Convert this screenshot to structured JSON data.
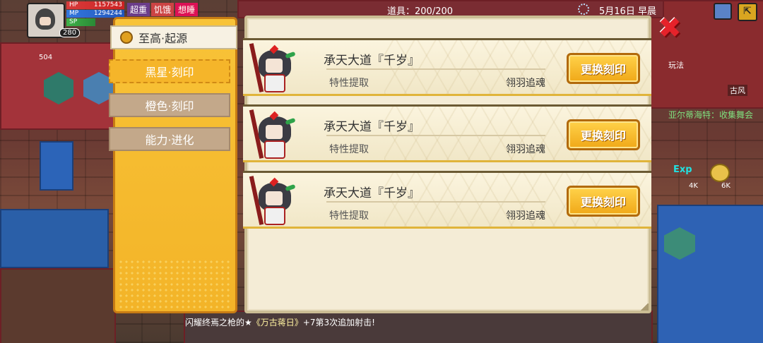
{
  "hud": {
    "hp_label": "HP",
    "hp_value": "1157543",
    "mp_label": "MP",
    "mp_value": "1294244",
    "sp_label": "SP",
    "level": "280",
    "status_tags": [
      "超重",
      "饥饿",
      "想睡"
    ],
    "count_504": "504"
  },
  "topbar": {
    "items": "道具：200/200",
    "date": "5月16日 早晨"
  },
  "side_world": {
    "play_label": "玩法",
    "zone_label": "古风",
    "quest": "亚尔蒂海特：收集舞会",
    "exp_label": "Exp",
    "exp_4k": "4K",
    "exp_6k": "6K"
  },
  "marquee": {
    "prefix": "闪耀终焉之枪的★",
    "highlight": "《万古蒋日》",
    "suffix": "+7第3次追加射击!"
  },
  "tabs": {
    "top": "至高·起源",
    "items": [
      {
        "label": "黑星·刻印",
        "active": true
      },
      {
        "label": "橙色·刻印",
        "active": false
      },
      {
        "label": "能力·进化",
        "active": false
      }
    ]
  },
  "rows": [
    {
      "title": "承天大道『千岁』",
      "subtitle": "特性提取",
      "skill": "翎羽追魂",
      "button": "更换刻印"
    },
    {
      "title": "承天大道『千岁』",
      "subtitle": "特性提取",
      "skill": "翎羽追魂",
      "button": "更换刻印"
    },
    {
      "title": "承天大道『千岁』",
      "subtitle": "特性提取",
      "skill": "翎羽追魂",
      "button": "更换刻印"
    }
  ],
  "close_glyph": "✖"
}
